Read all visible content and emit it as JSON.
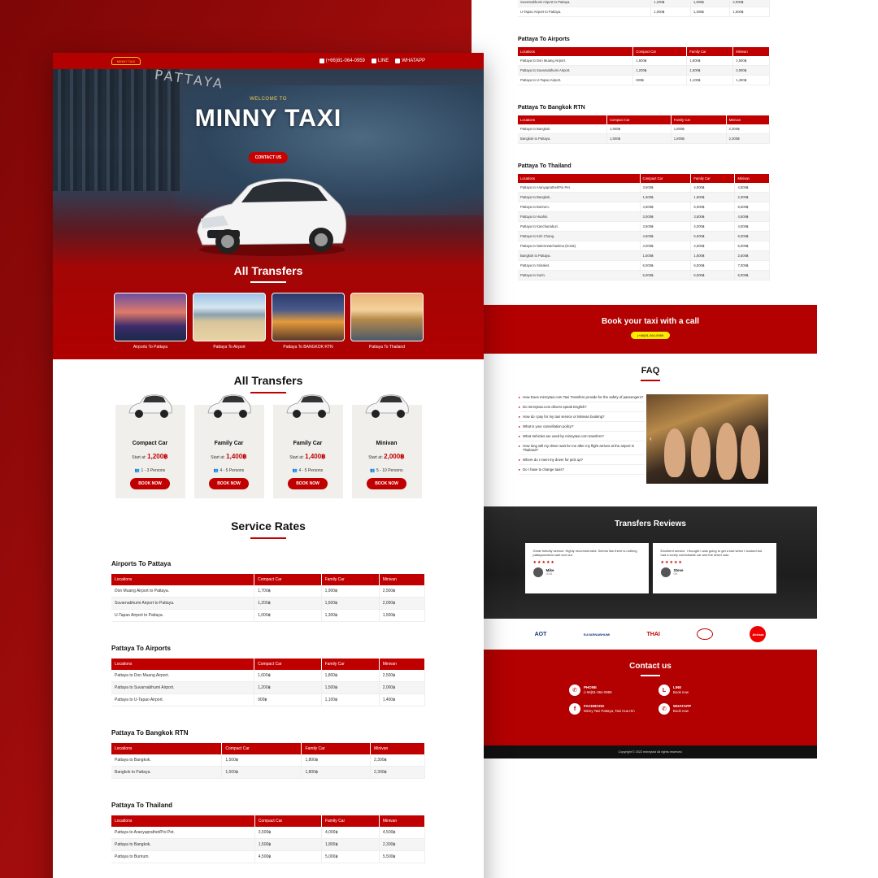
{
  "header": {
    "logo_text": "MINNY TAXI",
    "phone": "(+66)81-064-0959",
    "line": "LINE",
    "whatsapp": "WHATAPP"
  },
  "hero": {
    "sign": "PATTAYA",
    "welcome": "WELCOME TO",
    "brand": "MINNY TAXI",
    "cta": "CONTACT US",
    "section_title": "All Transfers",
    "destinations": [
      {
        "label": "Airports To Pattaya"
      },
      {
        "label": "Pattaya To Airport"
      },
      {
        "label": "Pattaya To BANGKOK RTN"
      },
      {
        "label": "Pattaya To Thailand"
      }
    ]
  },
  "transfers": {
    "title": "All Transfers",
    "cards": [
      {
        "name": "Compact Car",
        "start_label": "Start at:",
        "price": "1,200฿",
        "persons": "1 - 3 Persons",
        "book": "BOOK NOW"
      },
      {
        "name": "Family Car",
        "start_label": "Start at:",
        "price": "1,400฿",
        "persons": "4 - 5 Persons",
        "book": "BOOK NOW"
      },
      {
        "name": "Family Car",
        "start_label": "Start at:",
        "price": "1,400฿",
        "persons": "4 - 5 Persons",
        "book": "BOOK NOW"
      },
      {
        "name": "Minivan",
        "start_label": "Start at:",
        "price": "2,000฿",
        "persons": "5 - 10 Persons",
        "book": "BOOK NOW"
      }
    ]
  },
  "rates": {
    "title": "Service Rates",
    "columns": [
      "Locations",
      "Compact Car",
      "Family Car",
      "Minivan"
    ],
    "tables": [
      {
        "title": "Airports To Pattaya",
        "rows": [
          [
            "Don Muang Airport to Pattaya.",
            "1,700฿",
            "1,900฿",
            "2,500฿"
          ],
          [
            "Suvarnabhumi Airport to Pattaya.",
            "1,200฿",
            "1,600฿",
            "2,000฿"
          ],
          [
            "U-Tapao Airport to Pattaya.",
            "1,000฿",
            "1,300฿",
            "1,500฿"
          ]
        ]
      },
      {
        "title": "Pattaya To Airports",
        "rows": [
          [
            "Pattaya to Don Muang Airport.",
            "1,600฿",
            "1,800฿",
            "2,500฿"
          ],
          [
            "Pattaya to Suvarnabhumi Airport.",
            "1,200฿",
            "1,500฿",
            "2,000฿"
          ],
          [
            "Pattaya to U-Tapao Airport.",
            "900฿",
            "1,100฿",
            "1,400฿"
          ]
        ]
      },
      {
        "title": "Pattaya To Bangkok RTN",
        "rows": [
          [
            "Pattaya to Bangkok.",
            "1,500฿",
            "1,800฿",
            "2,300฿"
          ],
          [
            "Bangkok to Pattaya.",
            "1,500฿",
            "1,800฿",
            "2,300฿"
          ]
        ]
      },
      {
        "title": "Pattaya To Thailand",
        "rows": [
          [
            "Pattaya to Aranyaprathet/Poi Pet.",
            "3,500฿",
            "4,000฿",
            "4,500฿"
          ],
          [
            "Pattaya to Bangkok.",
            "1,500฿",
            "1,800฿",
            "2,300฿"
          ],
          [
            "Pattaya to Burirum.",
            "4,500฿",
            "5,000฿",
            "5,500฿"
          ],
          [
            "Pattaya to Huahin.",
            "3,000฿",
            "3,500฿",
            "4,500฿"
          ],
          [
            "Pattaya to Kanchanaburi.",
            "3,500฿",
            "4,000฿",
            "4,500฿"
          ],
          [
            "Pattaya to Koh Chang.",
            "4,500฿",
            "5,000฿",
            "6,000฿"
          ],
          [
            "Pattaya to Nakornratchasima (Korat).",
            "4,000฿",
            "4,500฿",
            "5,000฿"
          ],
          [
            "Bangkok to Pattaya.",
            "1,500฿",
            "1,800฿",
            "2,500฿"
          ],
          [
            "Pattaya to Srisaket.",
            "6,000฿",
            "6,500฿",
            "7,000฿"
          ],
          [
            "Pattaya to Surin.",
            "5,000฿",
            "5,500฿",
            "6,000฿"
          ]
        ]
      }
    ]
  },
  "book_call": {
    "title": "Book your taxi with a call",
    "phone": "(+66)81-064-0959"
  },
  "faq": {
    "title": "FAQ",
    "items": [
      "How Does minnytaxi.com Taxi Transfers provide for the safety of passengers?",
      "Do minnytaxi.com drivers speak English?",
      "How do I pay for my taxi service or Minivan booking?",
      "What is your cancellation policy?",
      "What Vehicles are used by minnytaxi.com transfers?",
      "How long will my driver wait for me after my flight arrives at the airport in Thailand?",
      "Where do I meet my driver for pick up?",
      "Do I have to change taxis?"
    ]
  },
  "reviews": {
    "title": "Transfers Reviews",
    "items": [
      {
        "text": "Great friendly service. Highly recommended. Seems like there is nothing pattayacentral cant sort out.",
        "stars": "★★★★★",
        "name": "Mike",
        "country": "USA"
      },
      {
        "text": "Excellent service. I thought I was going to get a taxi when I booked but had a lovely comfortable car and the driver was",
        "stars": "★★★★★",
        "name": "Steve",
        "country": "UK"
      }
    ]
  },
  "partners": [
    "AOT",
    "SUVARNABHUMI",
    "THAI",
    "",
    "AirAsia"
  ],
  "contact": {
    "title": "Contact us",
    "items": [
      {
        "icon": "phone-icon",
        "label": "PHONE",
        "value": "(+66)81-064-0959"
      },
      {
        "icon": "line-icon",
        "label": "LINE",
        "value": "Book now"
      },
      {
        "icon": "facebook-icon",
        "label": "FACEBOOK",
        "value": "Minny Taxi Pattaya, Taxi Hua Hin"
      },
      {
        "icon": "whatsapp-icon",
        "label": "WHATAPP",
        "value": "Book now"
      }
    ],
    "copyright": "Copyright © 2022 minnytaxi All rights reserved."
  },
  "colors": {
    "brand_red": "#b30000",
    "accent_yellow": "#ffec00",
    "cta_red": "#c00000"
  }
}
